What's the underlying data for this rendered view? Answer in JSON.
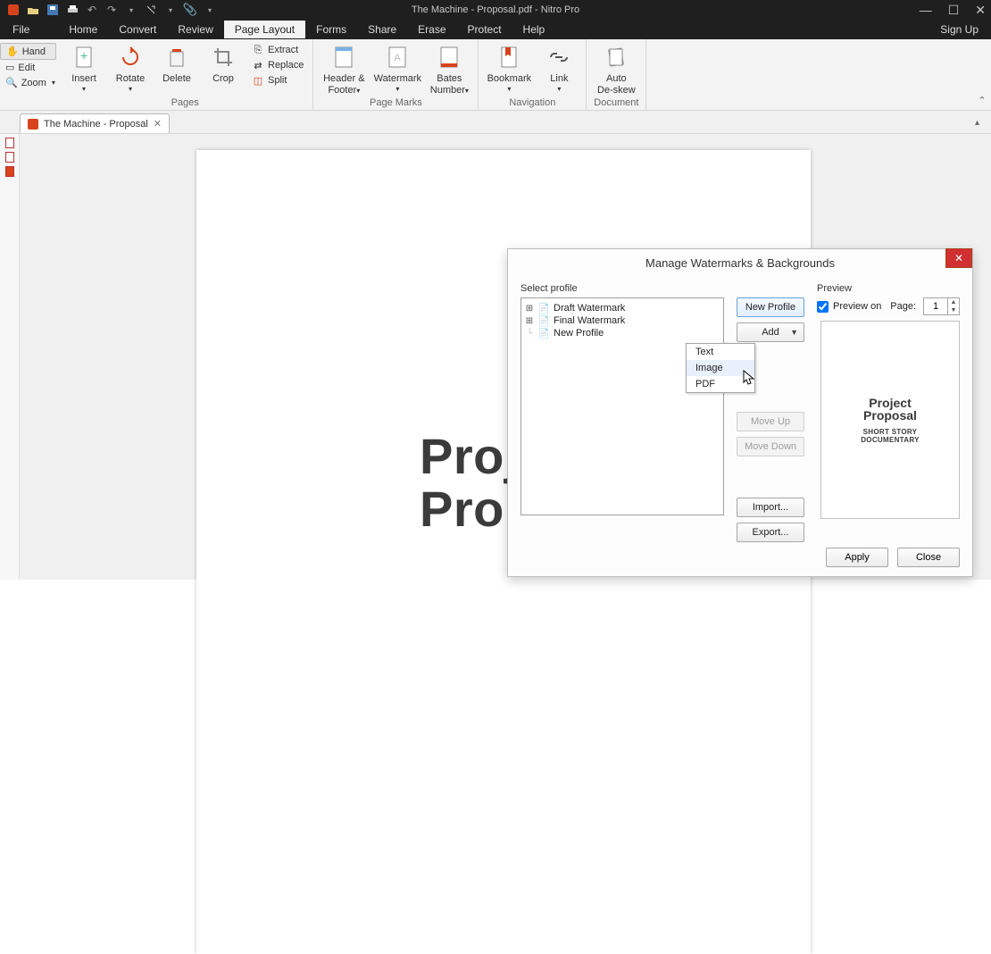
{
  "app": {
    "title": "The Machine - Proposal.pdf - Nitro Pro",
    "signup": "Sign Up"
  },
  "menu": {
    "file": "File",
    "tabs": [
      "Home",
      "Convert",
      "Review",
      "Page Layout",
      "Forms",
      "Share",
      "Erase",
      "Protect",
      "Help"
    ],
    "active_index": 3
  },
  "side": {
    "hand": "Hand",
    "edit": "Edit",
    "zoom": "Zoom"
  },
  "ribbon": {
    "pages": {
      "insert": "Insert",
      "rotate": "Rotate",
      "delete": "Delete",
      "crop": "Crop",
      "extract": "Extract",
      "replace": "Replace",
      "split": "Split",
      "label": "Pages"
    },
    "pagemarks": {
      "hf": "Header &",
      "hf2": "Footer",
      "wm": "Watermark",
      "bates": "Bates",
      "bates2": "Number",
      "label": "Page Marks"
    },
    "nav": {
      "bookmark": "Bookmark",
      "link": "Link",
      "label": "Navigation"
    },
    "doc": {
      "auto": "Auto",
      "auto2": "De-skew",
      "label": "Document"
    }
  },
  "doctab": {
    "name": "The Machine - Proposal"
  },
  "page": {
    "line1": "Proje",
    "line2": "Propo"
  },
  "dialog": {
    "title": "Manage Watermarks & Backgrounds",
    "select_profile": "Select profile",
    "tree": [
      "Draft Watermark",
      "Final Watermark",
      "New Profile"
    ],
    "btn_newprofile": "New Profile",
    "btn_add": "Add",
    "btn_moveup": "Move Up",
    "btn_movedown": "Move Down",
    "btn_import": "Import...",
    "btn_export": "Export...",
    "preview": "Preview",
    "preview_on": "Preview on",
    "page_lbl": "Page:",
    "page_val": "1",
    "apply": "Apply",
    "close": "Close"
  },
  "addmenu": {
    "items": [
      "Text",
      "Image",
      "PDF"
    ],
    "hover_index": 1
  },
  "preview_doc": {
    "l1": "Project",
    "l2": "Proposal",
    "l3": "SHORT STORY",
    "l4": "DOCUMENTARY"
  }
}
